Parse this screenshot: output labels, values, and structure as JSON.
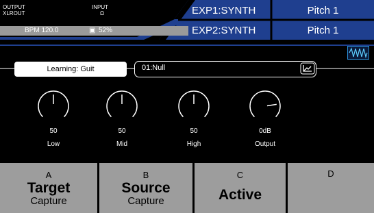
{
  "header": {
    "output_label": "OUTPUT",
    "xlrout_label": "XLROUT",
    "input_label": "INPUT",
    "input_icon": "Ω",
    "bpm": "BPM 120.0",
    "cpu": "52%",
    "exp1": "EXP1:SYNTH",
    "exp2": "EXP2:SYNTH",
    "exp1_value": "Pitch 1",
    "exp2_value": "Pitch 1",
    "accent_color": "#1f3f8f"
  },
  "learning": {
    "label": "Learning: Guit"
  },
  "preset": {
    "name": "01:Null"
  },
  "knobs": [
    {
      "value": "50",
      "label": "Low",
      "level": 0.5
    },
    {
      "value": "50",
      "label": "Mid",
      "level": 0.5
    },
    {
      "value": "50",
      "label": "High",
      "level": 0.5
    },
    {
      "value": "0dB",
      "label": "Output",
      "level": 0.8
    }
  ],
  "tabs": [
    {
      "letter": "A",
      "big": "Target",
      "sub": "Capture"
    },
    {
      "letter": "B",
      "big": "Source",
      "sub": "Capture"
    },
    {
      "letter": "C",
      "big": "Active",
      "sub": ""
    },
    {
      "letter": "D",
      "big": "",
      "sub": ""
    }
  ],
  "icons": {
    "waveform": "waveform-icon",
    "graph": "graph-icon",
    "cpu": "cpu-icon"
  }
}
